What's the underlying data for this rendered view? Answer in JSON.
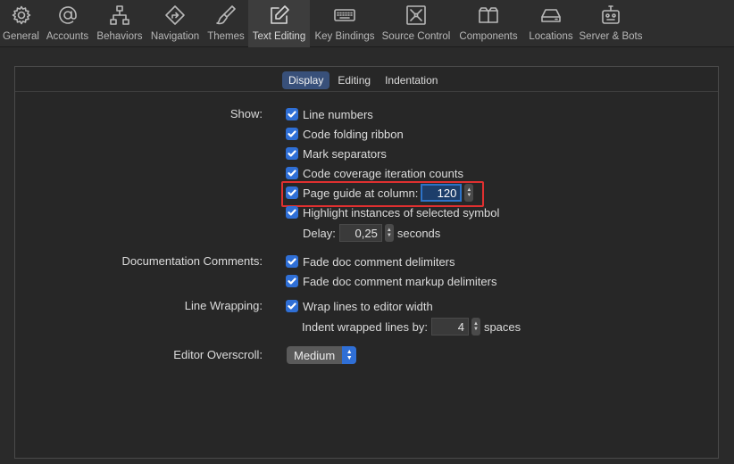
{
  "toolbar": {
    "items": [
      {
        "label": "General",
        "icon": "gear-icon"
      },
      {
        "label": "Accounts",
        "icon": "at-sign-icon"
      },
      {
        "label": "Behaviors",
        "icon": "hierarchy-icon"
      },
      {
        "label": "Navigation",
        "icon": "diamond-arrow-icon"
      },
      {
        "label": "Themes",
        "icon": "paintbrush-icon"
      },
      {
        "label": "Text Editing",
        "icon": "pencil-square-icon"
      },
      {
        "label": "Key Bindings",
        "icon": "keyboard-icon"
      },
      {
        "label": "Source Control",
        "icon": "source-control-icon"
      },
      {
        "label": "Components",
        "icon": "boxes-icon"
      },
      {
        "label": "Locations",
        "icon": "drive-icon"
      },
      {
        "label": "Server & Bots",
        "icon": "robot-icon"
      }
    ],
    "active": "Text Editing"
  },
  "tabs": {
    "items": [
      "Display",
      "Editing",
      "Indentation"
    ],
    "active": "Display"
  },
  "show": {
    "label": "Show:",
    "line_numbers": "Line numbers",
    "code_folding": "Code folding ribbon",
    "mark_separators": "Mark separators",
    "code_coverage": "Code coverage iteration counts",
    "page_guide": "Page guide at column:",
    "page_guide_value": "120",
    "highlight_instances": "Highlight instances of selected symbol",
    "delay_label": "Delay:",
    "delay_value": "0,25",
    "delay_unit": "seconds"
  },
  "doc_comments": {
    "label": "Documentation Comments:",
    "fade_delimiters": "Fade doc comment delimiters",
    "fade_markup": "Fade doc comment markup delimiters"
  },
  "line_wrapping": {
    "label": "Line Wrapping:",
    "wrap_lines": "Wrap lines to editor width",
    "indent_label": "Indent wrapped lines by:",
    "indent_value": "4",
    "indent_unit": "spaces"
  },
  "overscroll": {
    "label": "Editor Overscroll:",
    "value": "Medium"
  },
  "colors": {
    "accent": "#2f6fd6",
    "highlight_border": "#e03030",
    "active_tab": "#38507a"
  }
}
